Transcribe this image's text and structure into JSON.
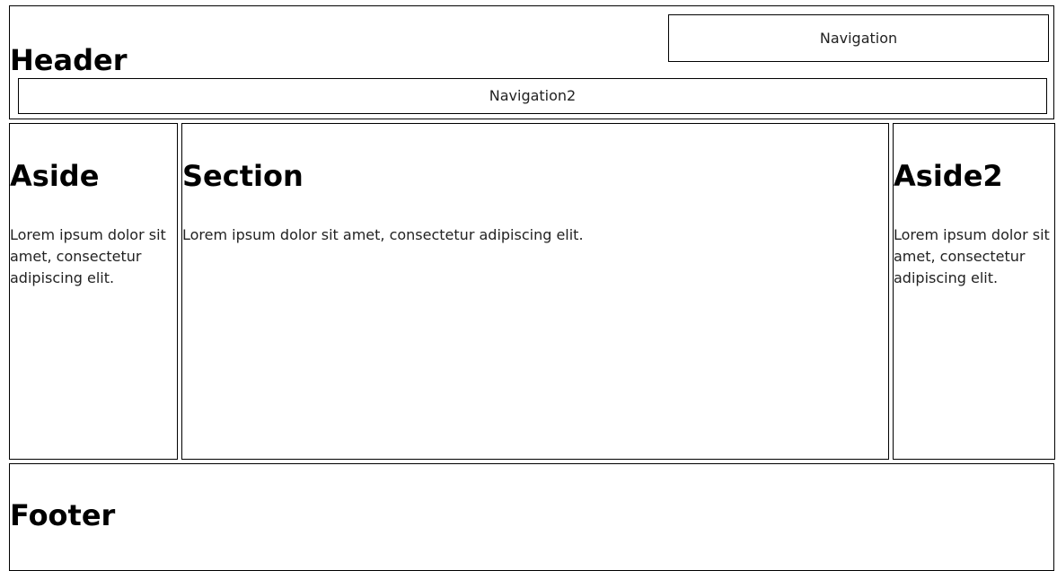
{
  "header": {
    "title": "Header",
    "nav_label": "Navigation",
    "nav2_label": "Navigation2"
  },
  "aside": {
    "title": "Aside",
    "text": "Lorem ipsum dolor sit amet, consectetur adipiscing elit."
  },
  "section": {
    "title": "Section",
    "text": "Lorem ipsum dolor sit amet, consectetur adipiscing elit."
  },
  "aside2": {
    "title": "Aside2",
    "text": "Lorem ipsum dolor sit amet, consectetur adipiscing elit."
  },
  "footer": {
    "title": "Footer"
  }
}
